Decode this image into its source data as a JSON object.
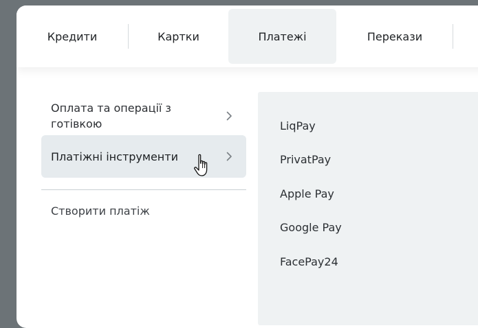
{
  "tabs": [
    {
      "label": "Кредити"
    },
    {
      "label": "Картки"
    },
    {
      "label": "Платежі"
    },
    {
      "label": "Перекази"
    }
  ],
  "menu": {
    "items": [
      {
        "label": "Оплата та операції з готівкою"
      },
      {
        "label": "Платіжні інструменти"
      }
    ],
    "create_label": "Створити платіж"
  },
  "submenu": {
    "items": [
      {
        "label": "LiqPay"
      },
      {
        "label": "PrivatPay"
      },
      {
        "label": "Apple Pay"
      },
      {
        "label": "Google Pay"
      },
      {
        "label": "FacePay24"
      }
    ]
  },
  "icons": {
    "chevron": "chevron-right-icon",
    "cursor": "hand-pointer-icon"
  },
  "colors": {
    "backdrop": "#6c7377",
    "active_bg": "#eff2f3",
    "selected_bg": "#e6ebee"
  }
}
